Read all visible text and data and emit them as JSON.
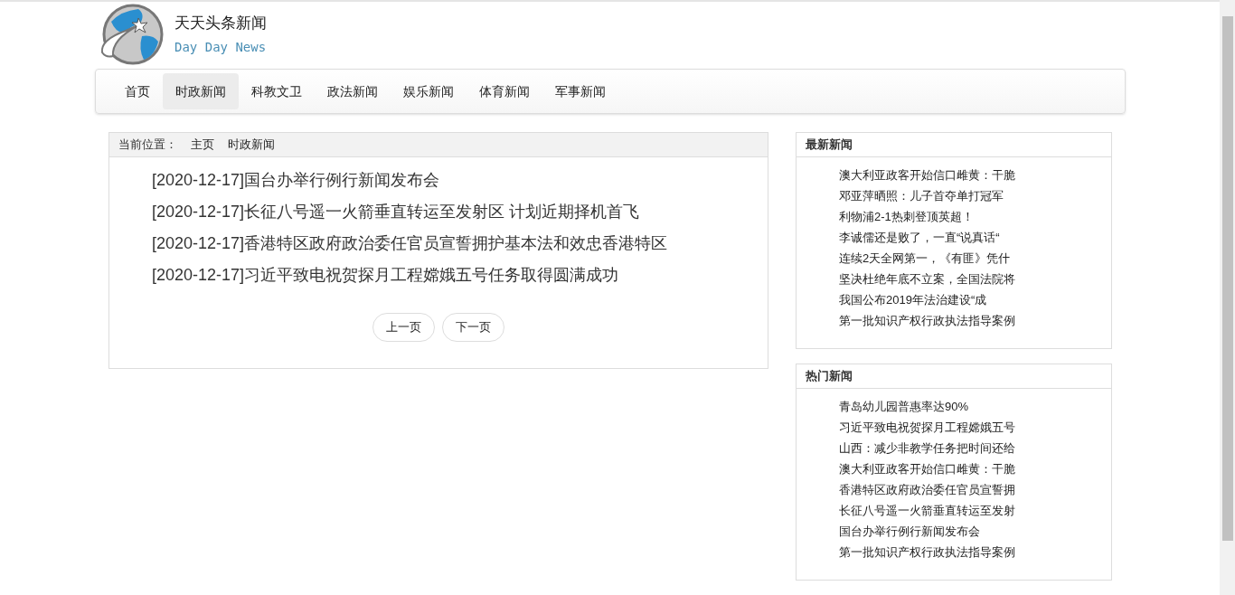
{
  "site": {
    "title": "天天头条新闻",
    "subtitle": "Day Day News"
  },
  "nav": [
    {
      "label": "首页",
      "selected": false
    },
    {
      "label": "时政新闻",
      "selected": true
    },
    {
      "label": "科教文卫",
      "selected": false
    },
    {
      "label": "政法新闻",
      "selected": false
    },
    {
      "label": "娱乐新闻",
      "selected": false
    },
    {
      "label": "体育新闻",
      "selected": false
    },
    {
      "label": "军事新闻",
      "selected": false
    }
  ],
  "breadcrumb": {
    "label": "当前位置：",
    "items": [
      "主页",
      "时政新闻"
    ]
  },
  "articles": [
    "[2020-12-17]国台办举行例行新闻发布会",
    "[2020-12-17]长征八号遥一火箭垂直转运至发射区 计划近期择机首飞",
    "[2020-12-17]香港特区政府政治委任官员宣誓拥护基本法和效忠香港特区",
    "[2020-12-17]习近平致电祝贺探月工程嫦娥五号任务取得圆满成功"
  ],
  "pagination": [
    "上一页",
    "下一页"
  ],
  "panels": [
    {
      "title": "最新新闻",
      "items": [
        "澳大利亚政客开始信口雌黄：干脆",
        "邓亚萍晒照：儿子首夺单打冠军",
        "利物浦2-1热刺登顶英超！",
        "李诚儒还是败了，一直“说真话“",
        "连续2天全网第一，《有匪》凭什",
        "坚决杜绝年底不立案，全国法院将",
        "我国公布2019年法治建设“成",
        "第一批知识产权行政执法指导案例"
      ]
    },
    {
      "title": "热门新闻",
      "items": [
        "青岛幼儿园普惠率达90%",
        "习近平致电祝贺探月工程嫦娥五号",
        "山西：减少非教学任务把时间还给",
        "澳大利亚政客开始信口雌黄：干脆",
        "香港特区政府政治委任官员宣誓拥",
        "长征八号遥一火箭垂直转运至发射",
        "国台办举行例行新闻发布会",
        "第一批知识产权行政执法指导案例"
      ]
    }
  ]
}
